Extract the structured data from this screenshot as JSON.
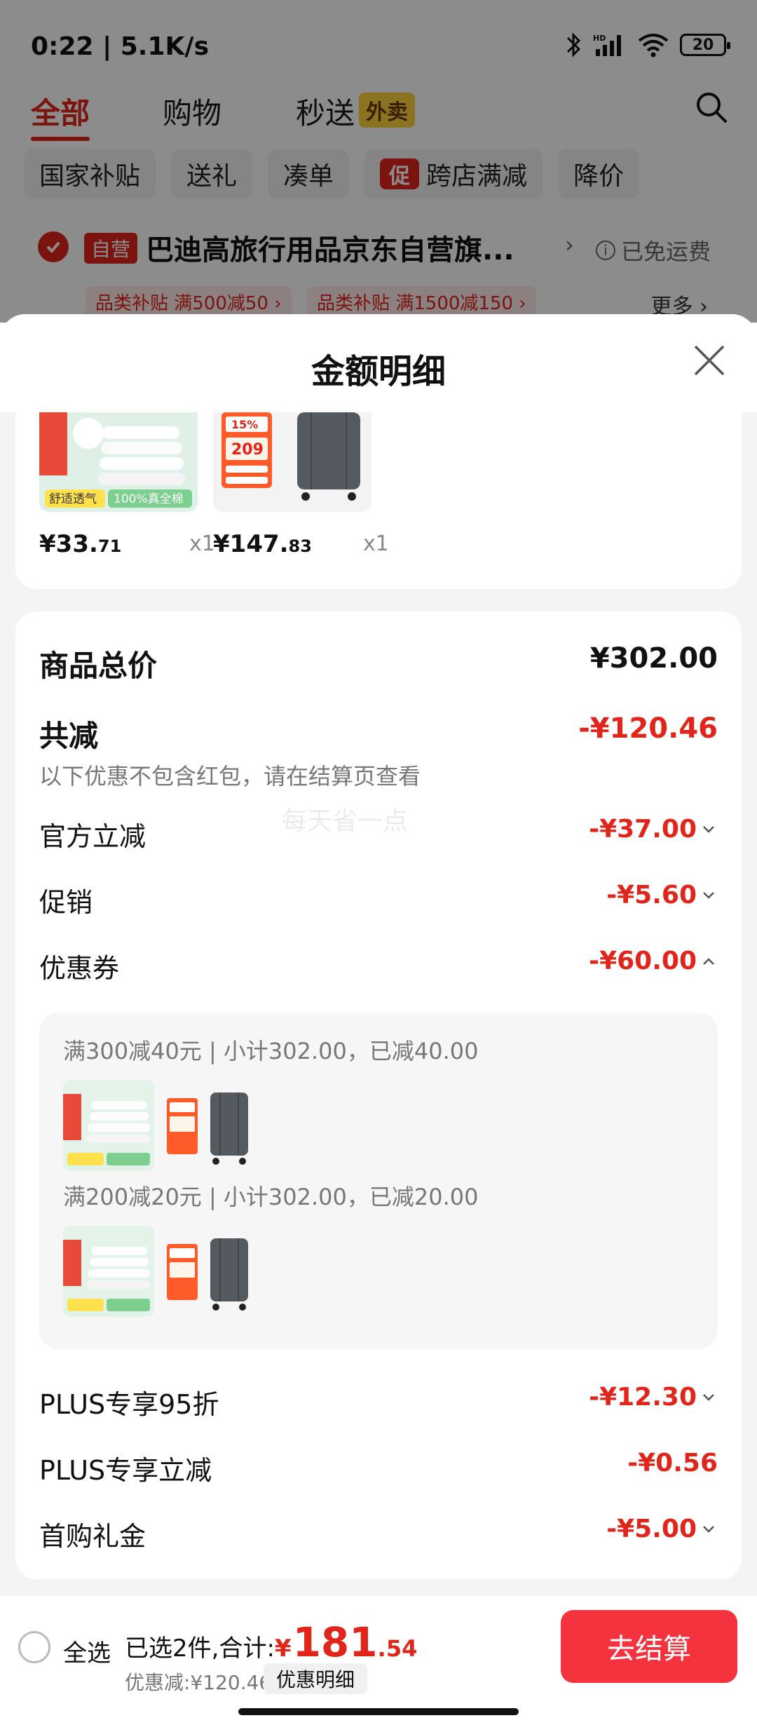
{
  "status_bar": {
    "time": "0:22 | 5.1K/s",
    "battery": "20"
  },
  "top_tabs": {
    "all": "全部",
    "shopping": "购物",
    "express": "秒送",
    "express_badge": "外卖"
  },
  "filter_chips": {
    "subsidy": "国家补贴",
    "gift": "送礼",
    "bundle": "凑单",
    "promo_badge": "促",
    "cross_store": "跨店满减",
    "price_drop": "降价"
  },
  "store": {
    "tag": "自营",
    "name": "巴迪高旅行用品京东自营旗...",
    "shipping": "已免运费",
    "promo1": "品类补贴 满500减50 ›",
    "promo2": "品类补贴 满1500减150 ›",
    "more": "更多 ›"
  },
  "sheet": {
    "title": "金额明细",
    "products": [
      {
        "price_int": "¥33.",
        "price_dec": "71",
        "qty": "x1",
        "img_badge": "舒适透气",
        "img_caption": "100%真全棉"
      },
      {
        "price_int": "¥147.",
        "price_dec": "83",
        "qty": "x1",
        "img_badge": "15%",
        "img_caption": "209"
      }
    ],
    "total_label": "商品总价",
    "total_value": "¥302.00",
    "discount_label": "共减",
    "discount_value": "-¥120.46",
    "discount_note": "以下优惠不包含红包，请在结算页查看",
    "watermark": "每天省一点",
    "items": [
      {
        "label": "官方立减",
        "value": "-¥37.00"
      },
      {
        "label": "促销",
        "value": "-¥5.60"
      },
      {
        "label": "优惠券",
        "value": "-¥60.00"
      }
    ],
    "coupons": [
      {
        "text": "满300减40元 | 小计302.00，已减40.00"
      },
      {
        "text": "满200减20元 | 小计302.00，已减20.00"
      }
    ],
    "items2": [
      {
        "label": "PLUS专享95折",
        "value": "-¥12.30"
      },
      {
        "label": "PLUS专享立减",
        "value": "-¥0.56"
      },
      {
        "label": "首购礼金",
        "value": "-¥5.00"
      }
    ]
  },
  "bottom_bar": {
    "select_all": "全选",
    "summary_prefix": "已选2件,合计:",
    "currency": "¥",
    "total_int": "181",
    "total_dec": ".54",
    "saved": "优惠减:¥120.46",
    "detail_button": "优惠明细",
    "checkout": "去结算"
  },
  "colors": {
    "accent": "#e1251b",
    "checkout": "#f5333f"
  }
}
